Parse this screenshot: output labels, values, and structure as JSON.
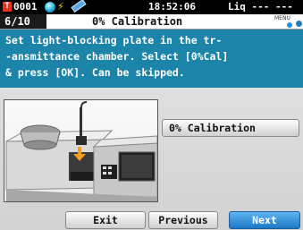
{
  "status": {
    "sample_badge": "T",
    "sample_no": "0001",
    "time": "18:52:06",
    "mode": "Liq --- ---",
    "icons": [
      "sample-t-icon",
      "lamp-icon",
      "flash-icon",
      "pencil-icon"
    ]
  },
  "header": {
    "step": "6/10",
    "title": "0% Calibration",
    "menu_label": "MENU"
  },
  "instruction": {
    "lines": [
      "Set light-blocking plate in the tr-",
      "-ansmittance chamber. Select [0%Cal]",
      "& press [OK]. Can be skipped."
    ]
  },
  "action": {
    "zero_cal_label": "0% Calibration"
  },
  "footer": {
    "exit_label": "Exit",
    "previous_label": "Previous",
    "next_label": "Next"
  },
  "colors": {
    "instruction_bg": "#1c84a8",
    "next_bg": "#1c78c6",
    "sample_badge": "#e8321e",
    "arrow": "#f39c1e"
  }
}
